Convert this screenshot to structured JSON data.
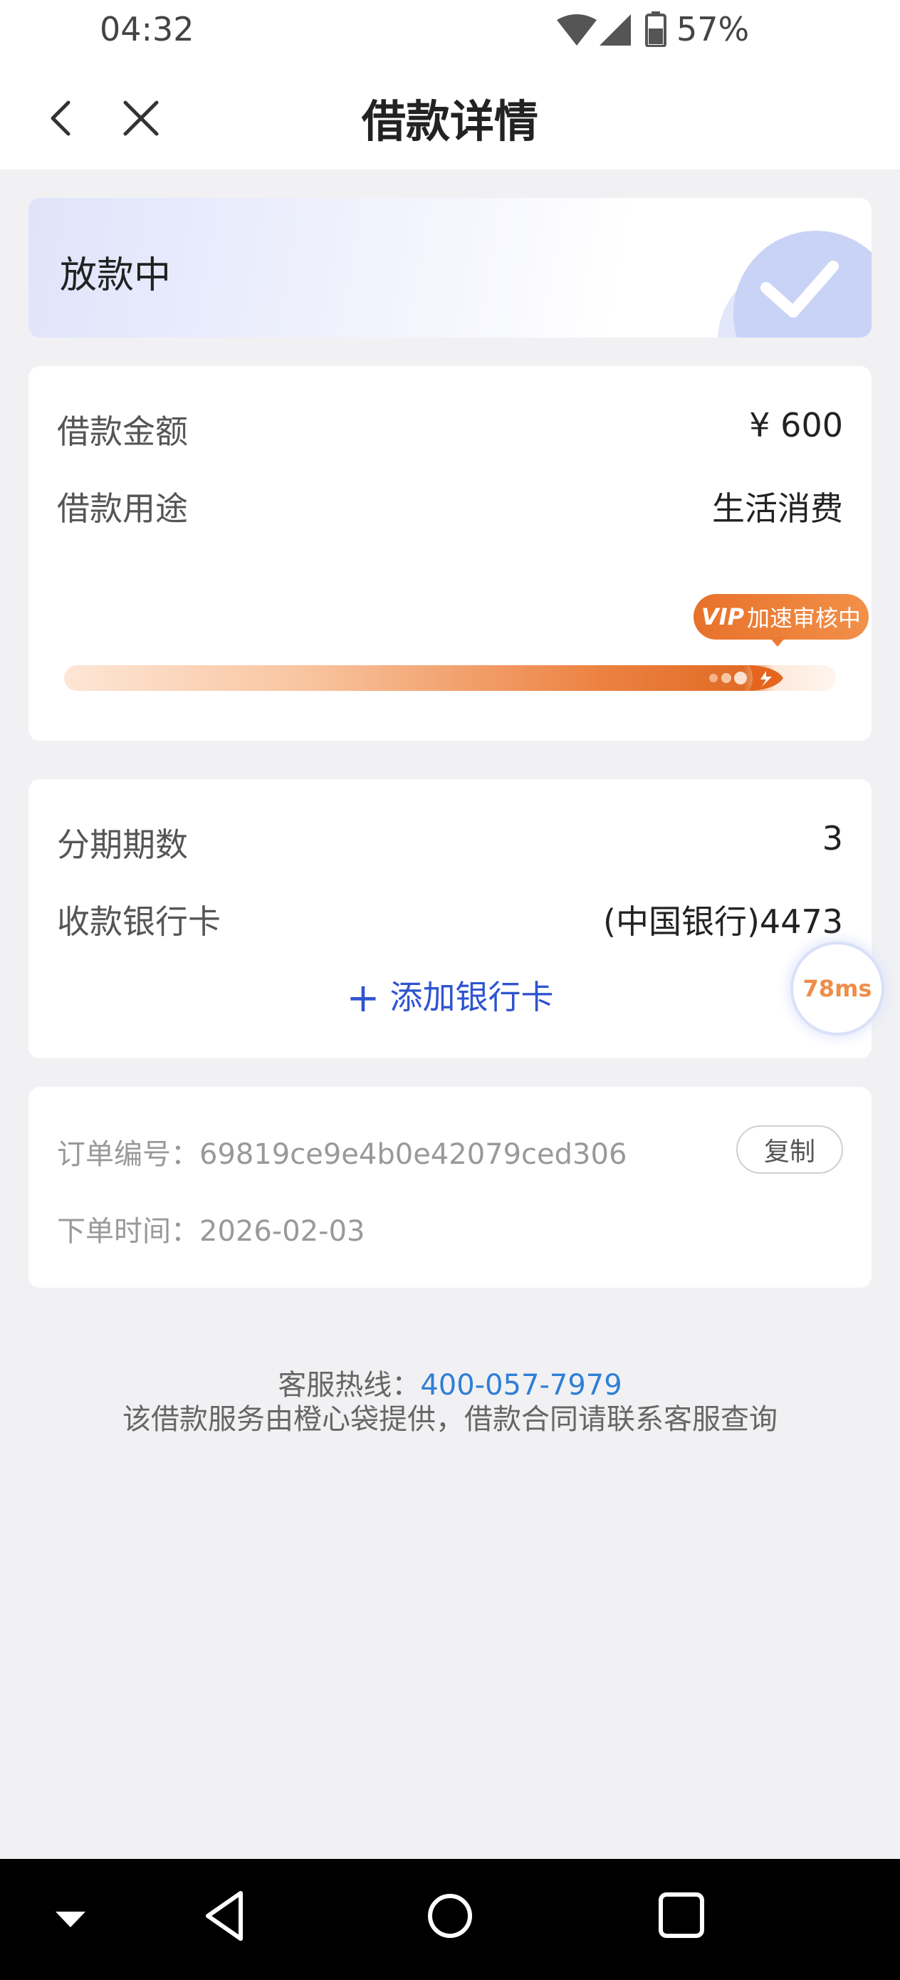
{
  "status_bar": {
    "time": "04:32",
    "battery_percent": "57%",
    "icons": [
      "wifi-icon",
      "cell-signal-icon",
      "battery-icon"
    ]
  },
  "header": {
    "title": "借款详情",
    "back_icon": "chevron-left-icon",
    "close_icon": "close-icon"
  },
  "status_card": {
    "status": "放款中",
    "icon": "check-circle-icon"
  },
  "loan_info": {
    "amount_label": "借款金额",
    "amount_value": "¥ 600",
    "purpose_label": "借款用途",
    "purpose_value": "生活消费",
    "badge_prefix": "VIP",
    "badge_text": "加速审核中"
  },
  "installment": {
    "periods_label": "分期期数",
    "periods_value": "3",
    "bank_label": "收款银行卡",
    "bank_value": "(中国银行)4473",
    "add_card_label": "添加银行卡"
  },
  "latency_badge": "78ms",
  "order": {
    "order_no_label": "订单编号：",
    "order_no_value": "69819ce9e4b0e42079ced306",
    "copy_label": "复制",
    "time_label": "下单时间：",
    "time_value": "2026-02-03"
  },
  "footer": {
    "hotline_label": "客服热线：",
    "hotline_number": "400-057-7979",
    "notice": "该借款服务由橙心袋提供，借款合同请联系客服查询"
  },
  "colors": {
    "accent_blue": "#2f54d0",
    "link_blue": "#2f7fd6",
    "orange": "#e8712a",
    "background": "#f1f1f3"
  }
}
